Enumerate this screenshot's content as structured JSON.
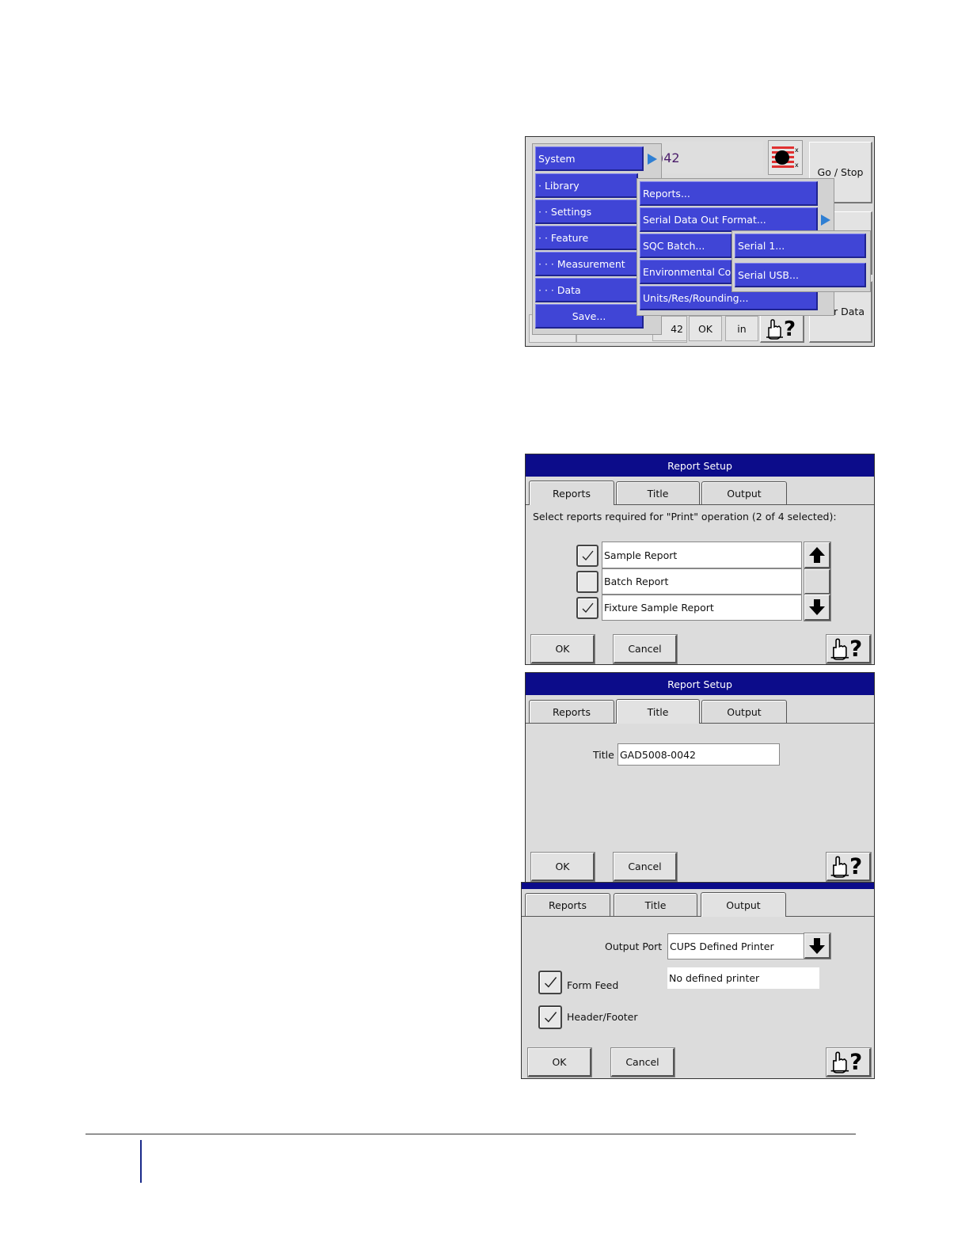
{
  "menu_screen": {
    "main_menu": [
      "System",
      "· Library",
      "· · Settings",
      "· · Feature",
      "· · · Measurement",
      "· · · Data",
      "Save..."
    ],
    "submenu": [
      "Reports...",
      "Serial Data Out Format...",
      "SQC Batch...",
      "Environmental Cor",
      "Units/Res/Rounding..."
    ],
    "serial_submenu": [
      "Serial 1...",
      "Serial USB..."
    ],
    "background": {
      "readout_partial": ")42",
      "go_stop": "Go / Stop",
      "clear_data_partial": "r Data",
      "value_partial": "42",
      "ok": "OK",
      "unit": "in"
    }
  },
  "report_reports_tab": {
    "title": "Report Setup",
    "tabs": [
      "Reports",
      "Title",
      "Output"
    ],
    "instruction": "Select reports required for \"Print\" operation (2 of 4 selected):",
    "reports": [
      {
        "label": "Sample Report",
        "checked": true
      },
      {
        "label": "Batch Report",
        "checked": false
      },
      {
        "label": "Fixture Sample Report",
        "checked": true
      }
    ],
    "ok": "OK",
    "cancel": "Cancel"
  },
  "report_title_tab": {
    "title": "Report Setup",
    "tabs": [
      "Reports",
      "Title",
      "Output"
    ],
    "title_label": "Title",
    "title_value": "GAD5008-0042",
    "ok": "OK",
    "cancel": "Cancel"
  },
  "report_output_tab": {
    "tabs": [
      "Reports",
      "Title",
      "Output"
    ],
    "output_port_label": "Output Port",
    "output_port_value": "CUPS Defined Printer",
    "printer_status": "No defined printer",
    "form_feed_label": "Form Feed",
    "form_feed_checked": true,
    "header_footer_label": "Header/Footer",
    "header_footer_checked": true,
    "ok": "OK",
    "cancel": "Cancel"
  },
  "colors": {
    "menu_blue": "#4045d6",
    "titlebar_navy": "#0c0c8a",
    "arrow_blue": "#2f7fd3",
    "footer_line": "#1a2a8a"
  }
}
